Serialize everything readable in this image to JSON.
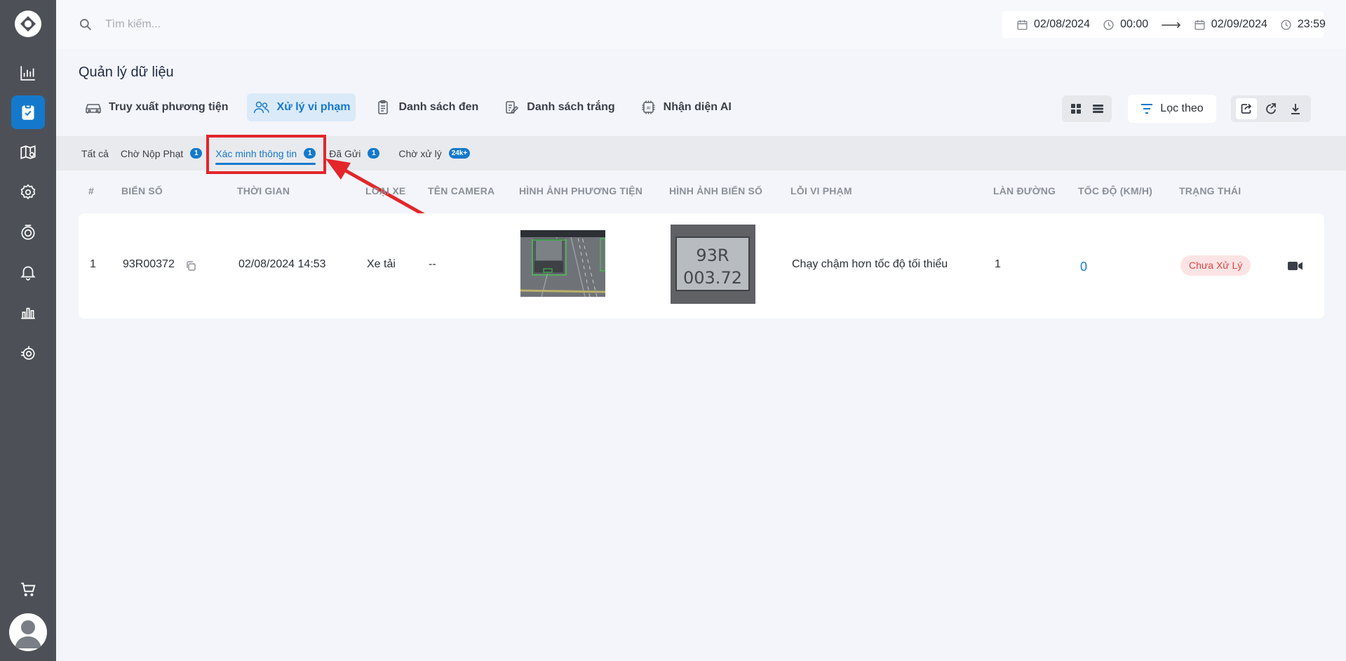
{
  "search": {
    "placeholder": "Tìm kiếm..."
  },
  "date_range": {
    "start_date": "02/08/2024",
    "start_time": "00:00",
    "end_date": "02/09/2024",
    "end_time": "23:59"
  },
  "page": {
    "title": "Quản lý dữ liệu"
  },
  "main_tabs": [
    {
      "label": "Truy xuất phương tiện",
      "icon": "car-icon"
    },
    {
      "label": "Xử lý vi phạm",
      "icon": "users-icon",
      "active": true
    },
    {
      "label": "Danh sách đen",
      "icon": "clipboard-icon"
    },
    {
      "label": "Danh sách trắng",
      "icon": "edit-list-icon"
    },
    {
      "label": "Nhận diện AI",
      "icon": "ai-chip-icon"
    }
  ],
  "filter": {
    "label": "Lọc theo"
  },
  "sub_tabs": [
    {
      "label": "Tất cả"
    },
    {
      "label": "Chờ Nộp Phạt",
      "badge": "1"
    },
    {
      "label": "Xác minh thông tin",
      "badge": "1",
      "active": true
    },
    {
      "label": "Đã Gửi",
      "badge": "1"
    },
    {
      "label": "Chờ xử lý",
      "badge": "24k+"
    }
  ],
  "table": {
    "headers": [
      "#",
      "BIỂN SỐ",
      "THỜI GIAN",
      "LOẠI XE",
      "TÊN CAMERA",
      "HÌNH ẢNH PHƯƠNG TIỆN",
      "HÌNH ẢNH BIỂN SỐ",
      "LỖI VI PHẠM",
      "LÀN ĐƯỜNG",
      "TỐC ĐỘ (KM/H)",
      "TRẠNG THÁI"
    ],
    "rows": [
      {
        "index": "1",
        "plate": "93R00372",
        "time": "02/08/2024 14:53",
        "vehicle_type": "Xe tải",
        "camera": "--",
        "plate_image_text_1": "93R",
        "plate_image_text_2": "003.72",
        "violation": "Chạy chậm hơn tốc độ tối thiểu",
        "lane": "1",
        "speed": "0",
        "status": "Chưa Xử Lý"
      }
    ]
  },
  "colors": {
    "accent": "#1479cc",
    "sidebar": "#4d5057",
    "status_bg": "#fde4e4",
    "status_text": "#e04545",
    "highlight": "#e3262a"
  }
}
